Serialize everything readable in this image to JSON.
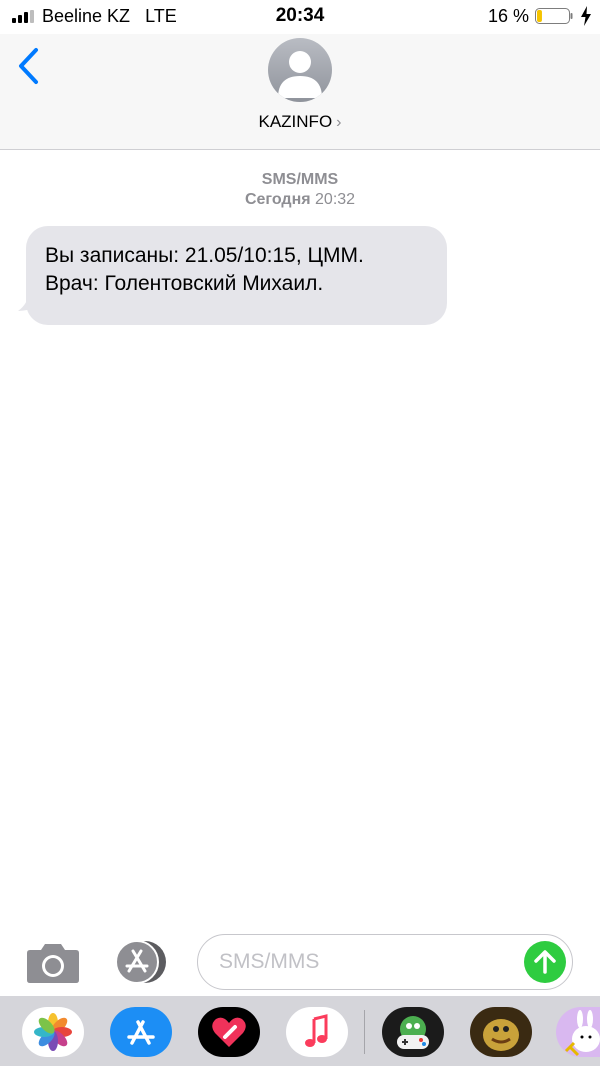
{
  "status_bar": {
    "carrier": "Beeline KZ",
    "network": "LTE",
    "time": "20:34",
    "battery_percent": "16 %",
    "battery_level": 0.16,
    "signal_bars": 3
  },
  "header": {
    "contact_name": "KAZINFO",
    "chevron": "›",
    "icons": [
      "back-chevron-icon",
      "contact-avatar-icon",
      "chevron-right-icon"
    ]
  },
  "conversation": {
    "service_label": "SMS/MMS",
    "date_label": "Сегодня",
    "date_time": "20:32",
    "messages": [
      {
        "line1": "Вы записаны: 21.05/10:15, ЦММ.",
        "line2": "Врач: Голентовский Михаил."
      }
    ]
  },
  "composer": {
    "placeholder": "SMS/MMS",
    "icons": [
      "camera-icon",
      "app-store-icon",
      "send-arrow-icon"
    ]
  },
  "app_drawer": {
    "apps": [
      "photos-icon",
      "app-store-icon",
      "digital-touch-icon",
      "music-icon",
      "game-controller-icon",
      "meme-sticker-icon",
      "cartoon-sticker-icon"
    ]
  },
  "colors": {
    "accent": "#007aff",
    "bubble": "#e5e5ea",
    "send": "#2ecc40",
    "meta_text": "#8e8e93",
    "battery_fill": "#f5c400"
  }
}
